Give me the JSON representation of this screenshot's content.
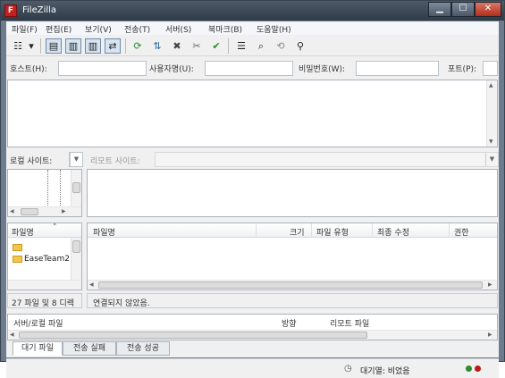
{
  "window": {
    "title": "FileZilla",
    "app_icon_glyph": "F",
    "controls": [
      "minimize-icon",
      "maximize-icon",
      "close-icon"
    ],
    "colors": {
      "titlebar": "#2f3a46",
      "close": "#b32c17"
    }
  },
  "menu": {
    "items": [
      "파일(F)",
      "편집(E)",
      "보기(V)",
      "전송(T)",
      "서버(S)",
      "북마크(B)",
      "도움말(H)"
    ]
  },
  "toolbar": {
    "buttons": [
      {
        "icon": "site-manager-icon",
        "glyph": "☷"
      },
      {
        "icon": "dropdown-arrow-icon",
        "glyph": "▾"
      },
      {
        "icon": "toggle-log-icon",
        "glyph": "▤"
      },
      {
        "icon": "toggle-local-tree-icon",
        "glyph": "▥"
      },
      {
        "icon": "toggle-remote-tree-icon",
        "glyph": "▥"
      },
      {
        "icon": "toggle-queue-icon",
        "glyph": "⇄"
      },
      {
        "icon": "refresh-icon",
        "glyph": "⟳"
      },
      {
        "icon": "process-queue-icon",
        "glyph": "⇅"
      },
      {
        "icon": "cancel-icon",
        "glyph": "✖"
      },
      {
        "icon": "disconnect-icon",
        "glyph": "✂"
      },
      {
        "icon": "reconnect-icon",
        "glyph": "✔"
      },
      {
        "icon": "filter-icon",
        "glyph": "☰"
      },
      {
        "icon": "compare-icon",
        "glyph": "⌕"
      },
      {
        "icon": "sync-browse-icon",
        "glyph": "⟲"
      },
      {
        "icon": "search-icon",
        "glyph": "⚲"
      }
    ]
  },
  "quickconnect": {
    "host_label": "호스트(H):",
    "user_label": "사용자명(U):",
    "password_label": "비밀번호(W):",
    "port_label": "포트(P):",
    "host_value": "",
    "user_value": "",
    "password_value": "",
    "port_value": ""
  },
  "local": {
    "site_label": "로컬 사이트:",
    "site_value": "",
    "columns": [
      "파일명",
      "˄"
    ],
    "files": [
      "",
      "EaseTeam2"
    ],
    "status": "27 파일 및 8 디렉"
  },
  "remote": {
    "site_label": "리모트 사이트:",
    "site_value": "",
    "columns": [
      "파일명",
      "크기",
      "파일 유형",
      "최종 수정",
      "권한"
    ],
    "status": "연결되지 않았음."
  },
  "queue": {
    "columns": [
      "서버/로컬 파일",
      "방향",
      "리모트 파일"
    ],
    "tabs": [
      "대기 파일",
      "전송 실패",
      "전송 성공"
    ]
  },
  "statusbar": {
    "queue_text": "대기열: 비었음",
    "led_colors": [
      "#2e8b2e",
      "#c01818"
    ]
  }
}
